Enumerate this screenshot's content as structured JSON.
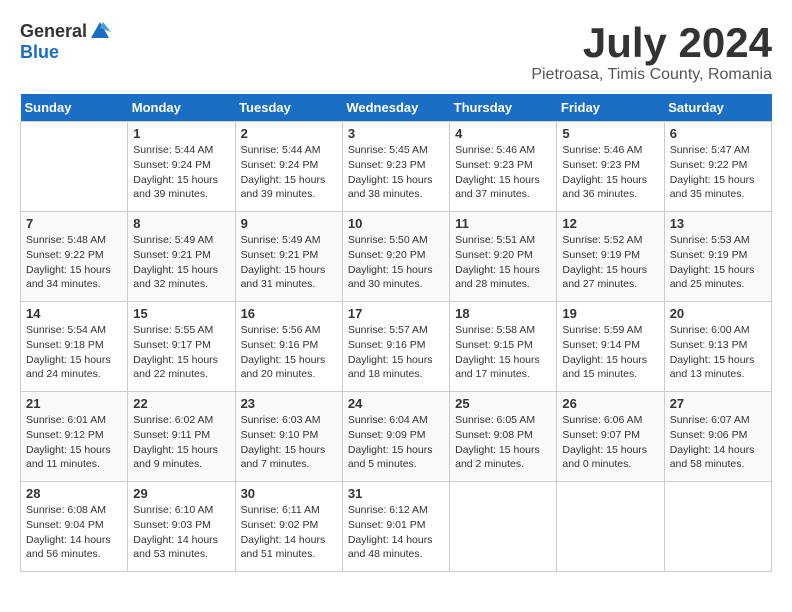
{
  "header": {
    "logo_general": "General",
    "logo_blue": "Blue",
    "title": "July 2024",
    "subtitle": "Pietroasa, Timis County, Romania"
  },
  "calendar": {
    "days_of_week": [
      "Sunday",
      "Monday",
      "Tuesday",
      "Wednesday",
      "Thursday",
      "Friday",
      "Saturday"
    ],
    "weeks": [
      [
        {
          "day": "",
          "info": ""
        },
        {
          "day": "1",
          "info": "Sunrise: 5:44 AM\nSunset: 9:24 PM\nDaylight: 15 hours\nand 39 minutes."
        },
        {
          "day": "2",
          "info": "Sunrise: 5:44 AM\nSunset: 9:24 PM\nDaylight: 15 hours\nand 39 minutes."
        },
        {
          "day": "3",
          "info": "Sunrise: 5:45 AM\nSunset: 9:23 PM\nDaylight: 15 hours\nand 38 minutes."
        },
        {
          "day": "4",
          "info": "Sunrise: 5:46 AM\nSunset: 9:23 PM\nDaylight: 15 hours\nand 37 minutes."
        },
        {
          "day": "5",
          "info": "Sunrise: 5:46 AM\nSunset: 9:23 PM\nDaylight: 15 hours\nand 36 minutes."
        },
        {
          "day": "6",
          "info": "Sunrise: 5:47 AM\nSunset: 9:22 PM\nDaylight: 15 hours\nand 35 minutes."
        }
      ],
      [
        {
          "day": "7",
          "info": "Sunrise: 5:48 AM\nSunset: 9:22 PM\nDaylight: 15 hours\nand 34 minutes."
        },
        {
          "day": "8",
          "info": "Sunrise: 5:49 AM\nSunset: 9:21 PM\nDaylight: 15 hours\nand 32 minutes."
        },
        {
          "day": "9",
          "info": "Sunrise: 5:49 AM\nSunset: 9:21 PM\nDaylight: 15 hours\nand 31 minutes."
        },
        {
          "day": "10",
          "info": "Sunrise: 5:50 AM\nSunset: 9:20 PM\nDaylight: 15 hours\nand 30 minutes."
        },
        {
          "day": "11",
          "info": "Sunrise: 5:51 AM\nSunset: 9:20 PM\nDaylight: 15 hours\nand 28 minutes."
        },
        {
          "day": "12",
          "info": "Sunrise: 5:52 AM\nSunset: 9:19 PM\nDaylight: 15 hours\nand 27 minutes."
        },
        {
          "day": "13",
          "info": "Sunrise: 5:53 AM\nSunset: 9:19 PM\nDaylight: 15 hours\nand 25 minutes."
        }
      ],
      [
        {
          "day": "14",
          "info": "Sunrise: 5:54 AM\nSunset: 9:18 PM\nDaylight: 15 hours\nand 24 minutes."
        },
        {
          "day": "15",
          "info": "Sunrise: 5:55 AM\nSunset: 9:17 PM\nDaylight: 15 hours\nand 22 minutes."
        },
        {
          "day": "16",
          "info": "Sunrise: 5:56 AM\nSunset: 9:16 PM\nDaylight: 15 hours\nand 20 minutes."
        },
        {
          "day": "17",
          "info": "Sunrise: 5:57 AM\nSunset: 9:16 PM\nDaylight: 15 hours\nand 18 minutes."
        },
        {
          "day": "18",
          "info": "Sunrise: 5:58 AM\nSunset: 9:15 PM\nDaylight: 15 hours\nand 17 minutes."
        },
        {
          "day": "19",
          "info": "Sunrise: 5:59 AM\nSunset: 9:14 PM\nDaylight: 15 hours\nand 15 minutes."
        },
        {
          "day": "20",
          "info": "Sunrise: 6:00 AM\nSunset: 9:13 PM\nDaylight: 15 hours\nand 13 minutes."
        }
      ],
      [
        {
          "day": "21",
          "info": "Sunrise: 6:01 AM\nSunset: 9:12 PM\nDaylight: 15 hours\nand 11 minutes."
        },
        {
          "day": "22",
          "info": "Sunrise: 6:02 AM\nSunset: 9:11 PM\nDaylight: 15 hours\nand 9 minutes."
        },
        {
          "day": "23",
          "info": "Sunrise: 6:03 AM\nSunset: 9:10 PM\nDaylight: 15 hours\nand 7 minutes."
        },
        {
          "day": "24",
          "info": "Sunrise: 6:04 AM\nSunset: 9:09 PM\nDaylight: 15 hours\nand 5 minutes."
        },
        {
          "day": "25",
          "info": "Sunrise: 6:05 AM\nSunset: 9:08 PM\nDaylight: 15 hours\nand 2 minutes."
        },
        {
          "day": "26",
          "info": "Sunrise: 6:06 AM\nSunset: 9:07 PM\nDaylight: 15 hours\nand 0 minutes."
        },
        {
          "day": "27",
          "info": "Sunrise: 6:07 AM\nSunset: 9:06 PM\nDaylight: 14 hours\nand 58 minutes."
        }
      ],
      [
        {
          "day": "28",
          "info": "Sunrise: 6:08 AM\nSunset: 9:04 PM\nDaylight: 14 hours\nand 56 minutes."
        },
        {
          "day": "29",
          "info": "Sunrise: 6:10 AM\nSunset: 9:03 PM\nDaylight: 14 hours\nand 53 minutes."
        },
        {
          "day": "30",
          "info": "Sunrise: 6:11 AM\nSunset: 9:02 PM\nDaylight: 14 hours\nand 51 minutes."
        },
        {
          "day": "31",
          "info": "Sunrise: 6:12 AM\nSunset: 9:01 PM\nDaylight: 14 hours\nand 48 minutes."
        },
        {
          "day": "",
          "info": ""
        },
        {
          "day": "",
          "info": ""
        },
        {
          "day": "",
          "info": ""
        }
      ]
    ]
  }
}
